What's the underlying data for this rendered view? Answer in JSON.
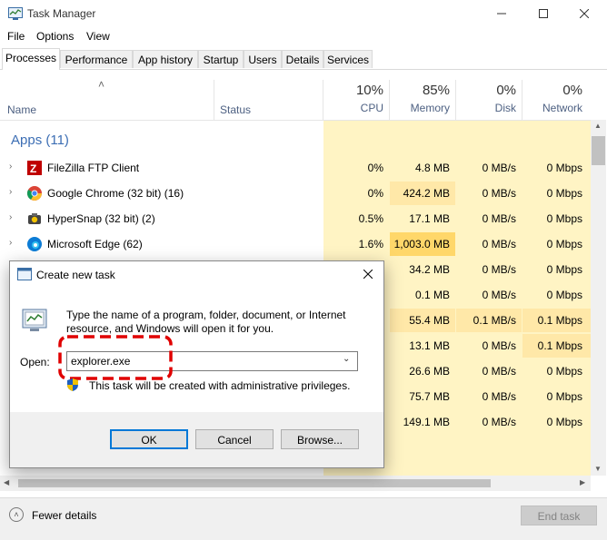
{
  "window": {
    "title": "Task Manager"
  },
  "menu": [
    "File",
    "Options",
    "View"
  ],
  "tabs": [
    "Processes",
    "Performance",
    "App history",
    "Startup",
    "Users",
    "Details",
    "Services"
  ],
  "header": {
    "name": "Name",
    "status": "Status",
    "cpu": {
      "pct": "10%",
      "label": "CPU"
    },
    "memory": {
      "pct": "85%",
      "label": "Memory"
    },
    "disk": {
      "pct": "0%",
      "label": "Disk"
    },
    "network": {
      "pct": "0%",
      "label": "Network"
    }
  },
  "group": {
    "label": "Apps (11)"
  },
  "rows": [
    {
      "name": "FileZilla FTP Client",
      "cpu": "0%",
      "memory": "4.8 MB",
      "disk": "0 MB/s",
      "network": "0 Mbps"
    },
    {
      "name": "Google Chrome (32 bit) (16)",
      "cpu": "0%",
      "memory": "424.2 MB",
      "disk": "0 MB/s",
      "network": "0 Mbps"
    },
    {
      "name": "HyperSnap (32 bit) (2)",
      "cpu": "0.5%",
      "memory": "17.1 MB",
      "disk": "0 MB/s",
      "network": "0 Mbps"
    },
    {
      "name": "Microsoft Edge (62)",
      "cpu": "1.6%",
      "memory": "1,003.0 MB",
      "disk": "0 MB/s",
      "network": "0 Mbps"
    }
  ],
  "hidden_rows": [
    {
      "memory": "34.2 MB",
      "disk": "0 MB/s",
      "network": "0 Mbps"
    },
    {
      "memory": "0.1 MB",
      "disk": "0 MB/s",
      "network": "0 Mbps"
    },
    {
      "memory": "55.4 MB",
      "disk": "0.1 MB/s",
      "network": "0.1 Mbps"
    },
    {
      "memory": "13.1 MB",
      "disk": "0 MB/s",
      "network": "0.1 Mbps"
    },
    {
      "memory": "26.6 MB",
      "disk": "0 MB/s",
      "network": "0 Mbps"
    },
    {
      "memory": "75.7 MB",
      "disk": "0 MB/s",
      "network": "0 Mbps"
    },
    {
      "memory": "149.1 MB",
      "disk": "0 MB/s",
      "network": "0 Mbps"
    }
  ],
  "footer": {
    "fewer_details": "Fewer details",
    "end_task": "End task"
  },
  "dialog": {
    "title": "Create new task",
    "description": "Type the name of a program, folder, document, or Internet resource, and Windows will open it for you.",
    "open_label": "Open:",
    "open_value": "explorer.exe",
    "admin_note": "This task will be created with administrative privileges.",
    "ok": "OK",
    "cancel": "Cancel",
    "browse": "Browse..."
  },
  "colors": {
    "accent": "#0078d7",
    "group_label": "#3c6eb4",
    "cpu_yellow": "#fff4c4",
    "highlight_red": "#e00000"
  }
}
